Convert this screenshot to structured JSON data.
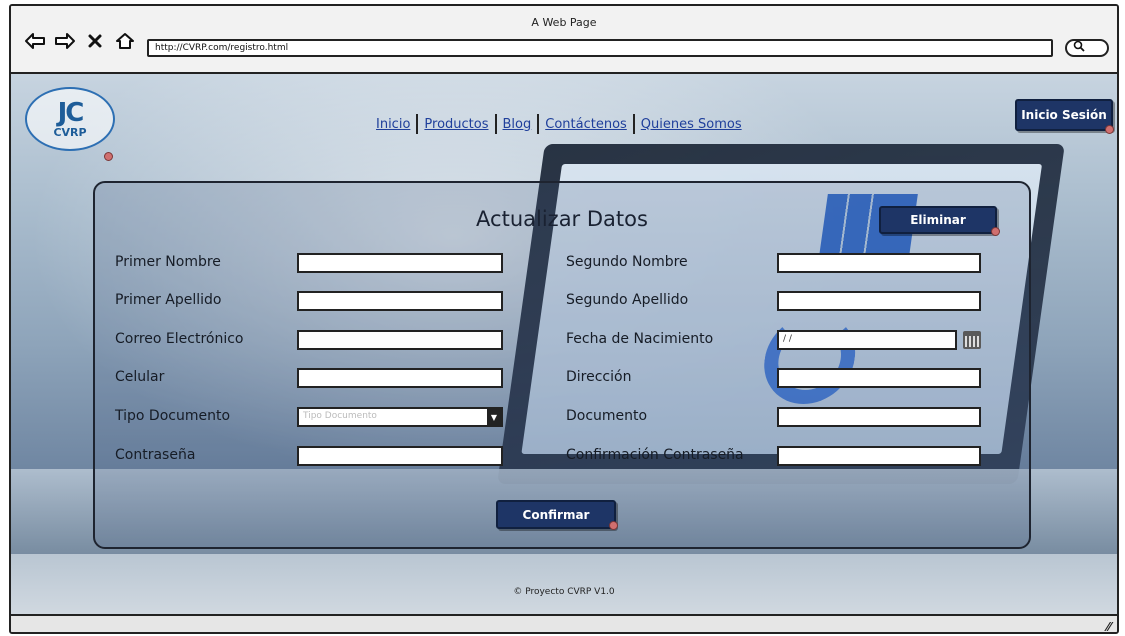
{
  "window": {
    "title": "A Web Page",
    "url": "http://CVRP.com/registro.html"
  },
  "logo": {
    "mark": "JC",
    "text": "CVRP"
  },
  "nav": {
    "items": [
      "Inicio",
      "Productos",
      "Blog",
      "Contáctenos",
      "Quienes Somos"
    ]
  },
  "header": {
    "login_label": "Inicio Sesión"
  },
  "form": {
    "title": "Actualizar Datos",
    "delete_label": "Eliminar",
    "confirm_label": "Confirmar",
    "labels": {
      "primer_nombre": "Primer Nombre",
      "segundo_nombre": "Segundo Nombre",
      "primer_apellido": "Primer Apellido",
      "segundo_apellido": "Segundo Apellido",
      "correo": "Correo Electrónico",
      "fecha_nacimiento": "Fecha de Nacimiento",
      "celular": "Celular",
      "direccion": "Dirección",
      "tipo_documento": "Tipo Documento",
      "documento": "Documento",
      "contrasena": "Contraseña",
      "confirmacion_contrasena": "Confirmación Contraseña"
    },
    "values": {
      "fecha_nacimiento": "/ /",
      "tipo_documento_placeholder": "Tipo Documento"
    }
  },
  "footer": {
    "text": "© Proyecto CVRP V1.0"
  },
  "colors": {
    "button": "#1e3566",
    "link": "#1f3f9b",
    "logo": "#1e5d99"
  }
}
